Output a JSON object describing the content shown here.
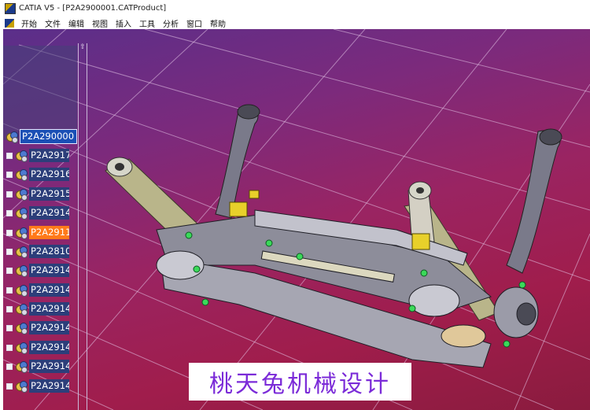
{
  "window": {
    "title": "CATIA V5 - [P2A2900001.CATProduct]"
  },
  "menu": [
    "开始",
    "文件",
    "编辑",
    "视图",
    "插入",
    "工具",
    "分析",
    "窗口",
    "帮助"
  ],
  "tree": {
    "root": "P2A290000",
    "nodes": [
      {
        "label": "P2A2917",
        "highlight": false
      },
      {
        "label": "P2A2916",
        "highlight": false
      },
      {
        "label": "P2A2915",
        "highlight": false
      },
      {
        "label": "P2A2914",
        "highlight": false
      },
      {
        "label": "P2A2911",
        "highlight": true
      },
      {
        "label": "P2A2810",
        "highlight": false
      },
      {
        "label": "P2A2914",
        "highlight": false
      },
      {
        "label": "P2A2914",
        "highlight": false
      },
      {
        "label": "P2A2914",
        "highlight": false
      },
      {
        "label": "P2A2914",
        "highlight": false
      },
      {
        "label": "P2A2914",
        "highlight": false
      },
      {
        "label": "P2A2914",
        "highlight": false
      },
      {
        "label": "P2A2914",
        "highlight": false
      }
    ]
  },
  "watermark": "桃天兔机械设计",
  "colors": {
    "background_top": "#5a2f8a",
    "background_bottom": "#a01d4c",
    "selected_node": "#ff7a1a",
    "tree_node": "#2c3e7a"
  },
  "icons": {
    "app": "catia-logo-icon",
    "part": "product-gears-icon",
    "expander": "tree-expander-icon"
  }
}
